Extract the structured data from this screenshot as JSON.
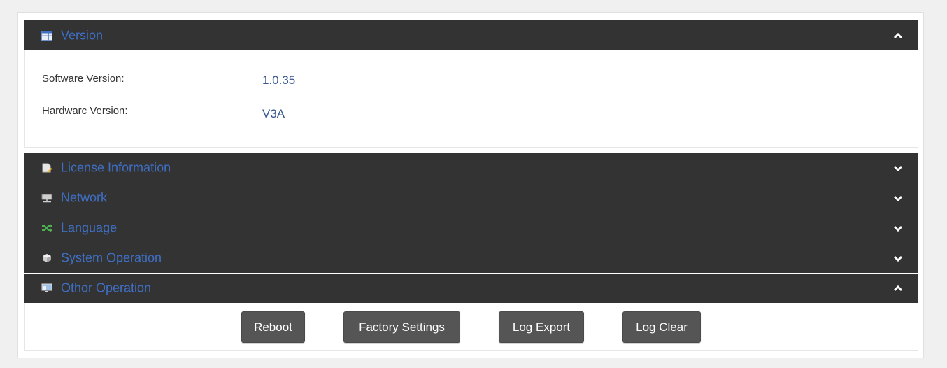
{
  "colors": {
    "header_bg": "#333333",
    "header_title": "#3f6fc4",
    "value_text": "#34568f",
    "button_bg": "#555555",
    "language_icon": "#4caf50"
  },
  "sections": [
    {
      "title": "Version",
      "icon": "table-icon",
      "state": "expanded"
    },
    {
      "title": "License Information",
      "icon": "license-icon",
      "state": "collapsed"
    },
    {
      "title": "Network",
      "icon": "network-icon",
      "state": "collapsed"
    },
    {
      "title": "Language",
      "icon": "shuffle-icon",
      "state": "collapsed"
    },
    {
      "title": "System Operation",
      "icon": "cube-icon",
      "state": "collapsed"
    },
    {
      "title": "Othor Operation",
      "icon": "monitor-icon",
      "state": "expanded"
    }
  ],
  "version": {
    "rows": [
      {
        "label": "Software Version:",
        "value": "1.0.35"
      },
      {
        "label": "Hardwarc Version:",
        "value": "V3A"
      }
    ]
  },
  "other_operation": {
    "buttons": [
      "Reboot",
      "Factory Settings",
      "Log Export",
      "Log Clear"
    ]
  }
}
